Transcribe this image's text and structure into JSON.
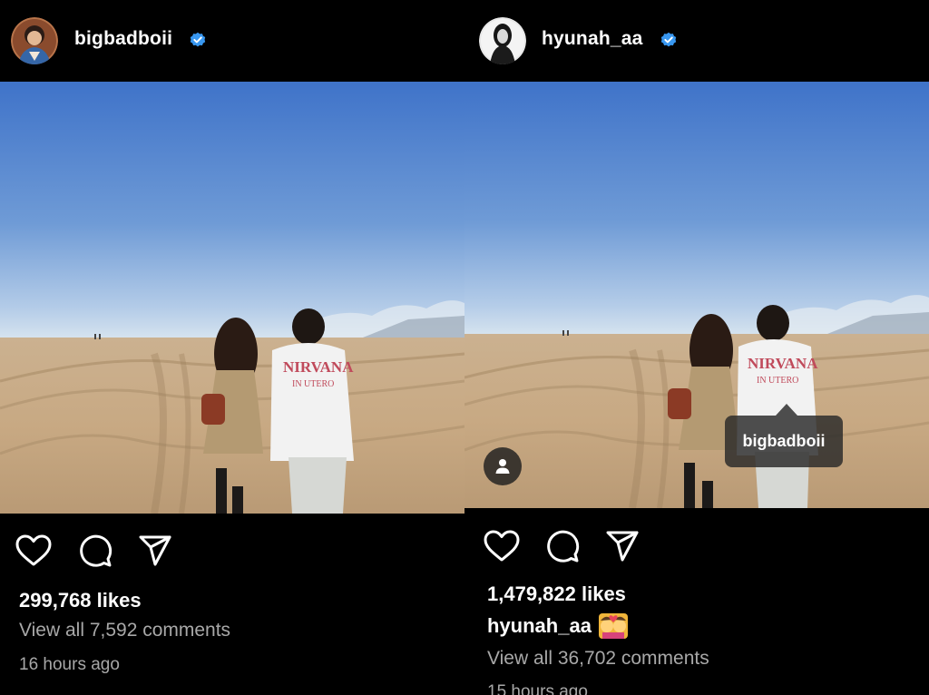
{
  "posts": [
    {
      "username": "bigbadboii",
      "verified": true,
      "likes": "299,768 likes",
      "comments_link": "View all 7,592 comments",
      "timestamp": "16 hours ago"
    },
    {
      "username": "hyunah_aa",
      "verified": true,
      "likes": "1,479,822 likes",
      "caption_username": "hyunah_aa",
      "caption_emoji": "couple-with-heart-emoji",
      "comments_link": "View all 36,702 comments",
      "timestamp": "15 hours ago",
      "tag": {
        "username": "bigbadboii",
        "icon": "user-tag-icon"
      },
      "tag_button_icon": "person-icon"
    }
  ],
  "icons": {
    "like": "heart-outline-icon",
    "comment": "comment-bubble-icon",
    "share": "paper-plane-icon",
    "verified": "verified-badge-icon"
  },
  "colors": {
    "background": "#000000",
    "text_primary": "#ffffff",
    "text_secondary": "#a8a8a8",
    "verified_blue": "#3897f0",
    "sky_top": "#3f73c9",
    "sky_bottom": "#c6d9ec",
    "sand": "#c7aa82"
  }
}
